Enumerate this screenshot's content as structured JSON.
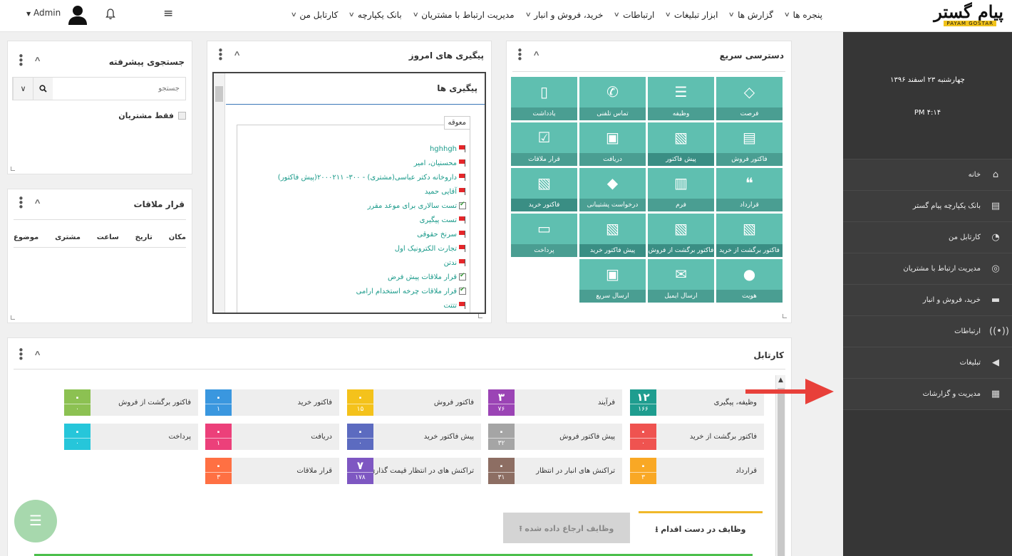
{
  "header": {
    "logo_text": "پیام گستر",
    "logo_subtext": "PAYAM GOSTAR",
    "menu": [
      {
        "label": "کارتابل من"
      },
      {
        "label": "بانک یکپارچه"
      },
      {
        "label": "مدیریت ارتباط با مشتریان"
      },
      {
        "label": "خرید، فروش و انبار"
      },
      {
        "label": "ارتباطات"
      },
      {
        "label": "ابزار تبلیغات"
      },
      {
        "label": "گزارش ها"
      },
      {
        "label": "پنجره ها"
      }
    ],
    "user_name": "Admin"
  },
  "sidebar": {
    "date": "چهارشنبه ۲۳ اسفند ۱۳۹۶",
    "time": "PM ۴:۱۴",
    "items": [
      {
        "label": "خانه",
        "icon": "home-icon"
      },
      {
        "label": "بانک یکپارچه پیام گستر",
        "icon": "database-icon"
      },
      {
        "label": "کارتابل من",
        "icon": "dashboard-icon"
      },
      {
        "label": "مدیریت ارتباط با مشتریان",
        "icon": "lifebuoy-icon"
      },
      {
        "label": "خرید، فروش و انبار",
        "icon": "truck-icon"
      },
      {
        "label": "ارتباطات",
        "icon": "broadcast-icon"
      },
      {
        "label": "تبلیغات",
        "icon": "megaphone-icon"
      },
      {
        "label": "مدیریت و گزارشات",
        "icon": "report-icon"
      }
    ]
  },
  "search_panel": {
    "title": "جستجوی پیشرفته",
    "placeholder": "جستجو",
    "only_customers": "فقط مشتریان"
  },
  "meetings_panel": {
    "title": "قرار ملاقات",
    "columns": [
      "مکان",
      "تاریخ",
      "ساعت",
      "مشتری",
      "موضوع"
    ]
  },
  "followups_panel": {
    "title": "پیگیری های امروز",
    "inner_title": "پیگیری ها",
    "legend": "معوقه",
    "items": [
      {
        "text": "hghhgh",
        "kind": "flag"
      },
      {
        "text": "محسنیان، امیر",
        "kind": "flag"
      },
      {
        "text": "داروخانه دکتر عباسی(مشتری) - ۳۰۰- ۲۰۰۰۲۱۱(پیش فاکتور)",
        "kind": "flag"
      },
      {
        "text": "آقایی حمید",
        "kind": "flag"
      },
      {
        "text": "تست سالاری برای موعد مقرر",
        "kind": "task"
      },
      {
        "text": "تست پیگیری",
        "kind": "flag"
      },
      {
        "text": "سرنخ حقوقی",
        "kind": "flag"
      },
      {
        "text": "تجارت الکترونیک اول",
        "kind": "flag"
      },
      {
        "text": "ندتن",
        "kind": "flag"
      },
      {
        "text": "قرار ملاقات پیش فرض",
        "kind": "task"
      },
      {
        "text": "قرار ملاقات چرخه استخدام ارامی",
        "kind": "task"
      },
      {
        "text": "تتتت",
        "kind": "flag"
      }
    ]
  },
  "quick_access": {
    "title": "دسترسی سریع",
    "tiles": [
      {
        "label": "فرصت",
        "icon": "diamond-icon"
      },
      {
        "label": "وظیفه",
        "icon": "tasks-icon"
      },
      {
        "label": "تماس تلفنی",
        "icon": "phone-icon"
      },
      {
        "label": "یادداشت",
        "icon": "note-icon"
      },
      {
        "label": "فاکتور فروش",
        "icon": "invoice-icon"
      },
      {
        "label": "پیش فاکتور",
        "icon": "proforma-icon"
      },
      {
        "label": "دریافت",
        "icon": "money-icon"
      },
      {
        "label": "قرار ملاقات",
        "icon": "calendar-icon"
      },
      {
        "label": "قرارداد",
        "icon": "quote-icon"
      },
      {
        "label": "فرم",
        "icon": "form-icon"
      },
      {
        "label": "درخواست پشتیبانی",
        "icon": "tag-icon"
      },
      {
        "label": "فاکتور خرید",
        "icon": "purchase-invoice-icon"
      },
      {
        "label": "فاکتور برگشت از خرید",
        "icon": "return-purchase-icon"
      },
      {
        "label": "فاکتور برگشت از فروش",
        "icon": "return-sale-icon"
      },
      {
        "label": "پیش فاکتور خرید",
        "icon": "purchase-proforma-icon"
      },
      {
        "label": "پرداخت",
        "icon": "card-icon"
      },
      {
        "label": "هویت",
        "icon": "user-icon"
      },
      {
        "label": "ارسال ایمیل",
        "icon": "email-icon"
      },
      {
        "label": "ارسال سریع",
        "icon": "quick-send-icon"
      }
    ]
  },
  "cartable": {
    "title": "کارتابل",
    "cards": [
      {
        "label": "وظیفه، پیگیری",
        "top": "۱۲",
        "bottom": "۱۶۶",
        "color": "#1e9d8f"
      },
      {
        "label": "فرآیند",
        "top": "۳",
        "bottom": "۷۶",
        "color": "#9b44b5"
      },
      {
        "label": "فاکتور فروش",
        "top": "۰",
        "bottom": "۱۵",
        "color": "#f4c21b"
      },
      {
        "label": "فاکتور خرید",
        "top": "۰",
        "bottom": "۱",
        "color": "#3a97df"
      },
      {
        "label": "فاکتور برگشت از فروش",
        "top": "۰",
        "bottom": "۰",
        "color": "#8cc152"
      },
      {
        "label": "فاکتور برگشت از خرید",
        "top": "۰",
        "bottom": "۰",
        "color": "#ef5350"
      },
      {
        "label": "پیش فاکتور فروش",
        "top": "۰",
        "bottom": "۳۲",
        "color": "#a5a5a5"
      },
      {
        "label": "پیش فاکتور خرید",
        "top": "۰",
        "bottom": "۰",
        "color": "#5c6bc0"
      },
      {
        "label": "دریافت",
        "top": "۰",
        "bottom": "۱",
        "color": "#ec407a"
      },
      {
        "label": "پرداخت",
        "top": "۰",
        "bottom": "۰",
        "color": "#26c6da"
      },
      {
        "label": "قرارداد",
        "top": "۰",
        "bottom": "۳",
        "color": "#f9a825"
      },
      {
        "label": "تراکنش های انبار در انتظار",
        "top": "۰",
        "bottom": "۳۱",
        "color": "#8d6e63"
      },
      {
        "label": "تراکنش های در انتظار قیمت گذاری",
        "top": "۷",
        "bottom": "۱۷۸",
        "color": "#7e57c2"
      },
      {
        "label": "قرار ملاقات",
        "top": "۰",
        "bottom": "۳",
        "color": "#ff7043"
      }
    ],
    "tab_active": "وظایف در دست اقدام",
    "tab_inactive": "وظایف ارجاع داده شده"
  }
}
